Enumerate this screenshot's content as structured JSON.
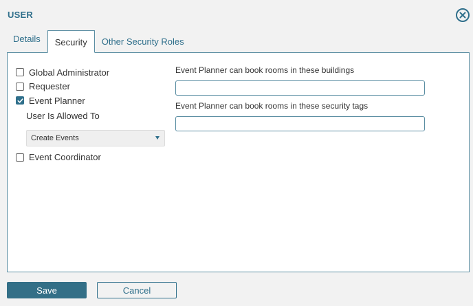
{
  "dialog": {
    "title": "USER"
  },
  "tabs": [
    {
      "label": "Details"
    },
    {
      "label": "Security"
    },
    {
      "label": "Other Security Roles"
    }
  ],
  "security": {
    "roles": [
      {
        "label": "Global Administrator",
        "checked": false
      },
      {
        "label": "Requester",
        "checked": false
      },
      {
        "label": "Event Planner",
        "checked": true
      },
      {
        "label": "Event Coordinator",
        "checked": false
      }
    ],
    "allowed_label": "User Is Allowed To",
    "allowed_value": "Create Events",
    "buildings_label": "Event Planner can book rooms in these buildings",
    "buildings_value": "",
    "tags_label": "Event Planner can book rooms in these security tags",
    "tags_value": ""
  },
  "footer": {
    "save_label": "Save",
    "cancel_label": "Cancel"
  },
  "colors": {
    "accent": "#2f6f8b",
    "border": "#5b8ea3",
    "background": "#f2f2f2"
  }
}
